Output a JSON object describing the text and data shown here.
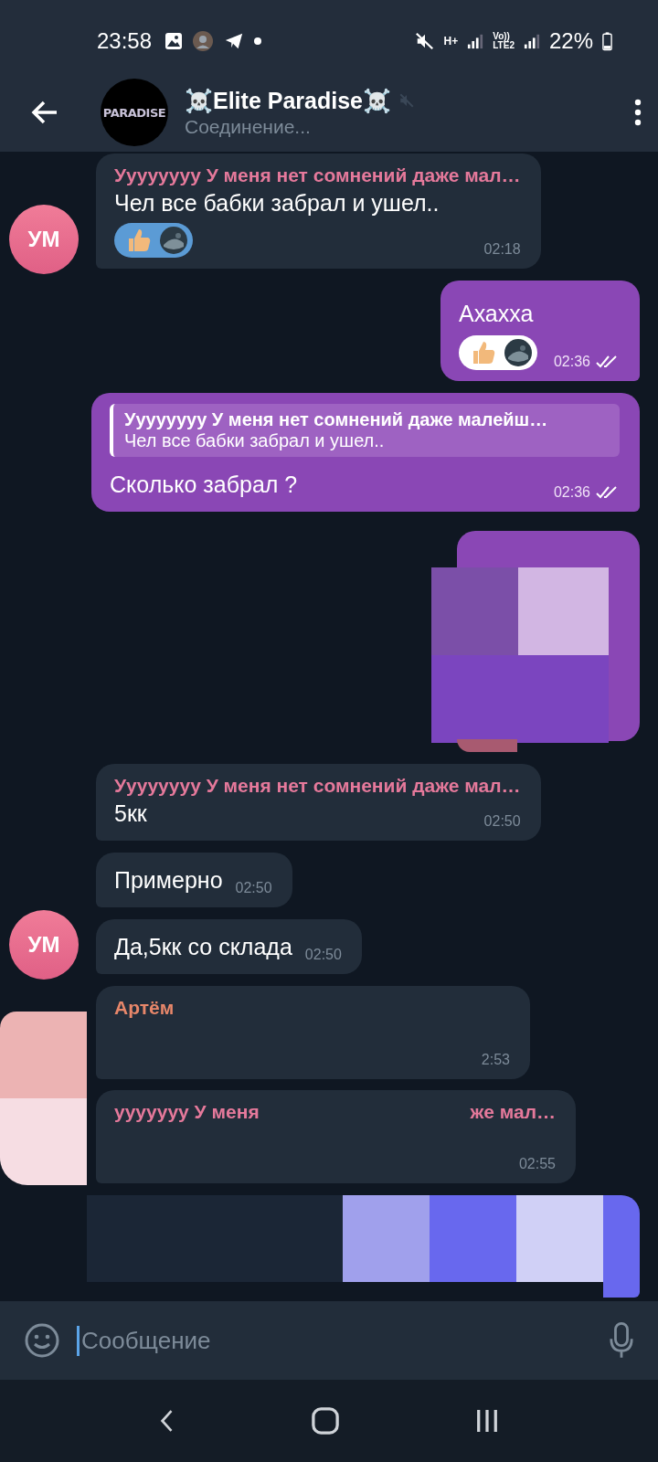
{
  "status_bar": {
    "time": "23:58",
    "network": "H+",
    "volte": "Vo))",
    "lte": "LTE2",
    "battery": "22%"
  },
  "header": {
    "avatar_text": "PARADISE",
    "title": "☠️Elite Paradise☠️",
    "muted": true,
    "subtitle": "Соединение..."
  },
  "messages": [
    {
      "kind": "incoming",
      "sender": "Уууууууу У меня нет сомнений даже мал…",
      "color": "#e5799b",
      "text": "Чел все бабки забрал и ушел..",
      "reactions": true,
      "time": "02:18",
      "avatar": "УМ"
    },
    {
      "kind": "outgoing",
      "text": "Ахахха",
      "reactions": true,
      "time": "02:36",
      "read": true
    },
    {
      "kind": "outgoing",
      "reply": {
        "author": "Уууууууу У меня нет сомнений даже малейш…",
        "text": "Чел все бабки забрал и ушел.."
      },
      "text": "Сколько забрал ?",
      "time": "02:36",
      "read": true
    },
    {
      "kind": "hidden-outgoing"
    },
    {
      "kind": "incoming",
      "sender": "Уууууууу У меня нет сомнений даже мал…",
      "color": "#e5799b",
      "text": "5кк",
      "time": "02:50"
    },
    {
      "kind": "incoming",
      "text": "Примерно",
      "time": "02:50"
    },
    {
      "kind": "incoming",
      "text": "Да,5кк со склада",
      "time": "02:50",
      "avatar": "УМ"
    },
    {
      "kind": "hidden-incoming",
      "sender": "Артём",
      "color": "#e8876a",
      "time": "2:53"
    },
    {
      "kind": "hidden-incoming",
      "sender": "ууууууу У меня",
      "sender_tail": "же мал…",
      "color": "#e5799b",
      "time": "02:55"
    },
    {
      "kind": "hidden-outgoing-blue"
    }
  ],
  "composer": {
    "placeholder": "Сообщение"
  }
}
